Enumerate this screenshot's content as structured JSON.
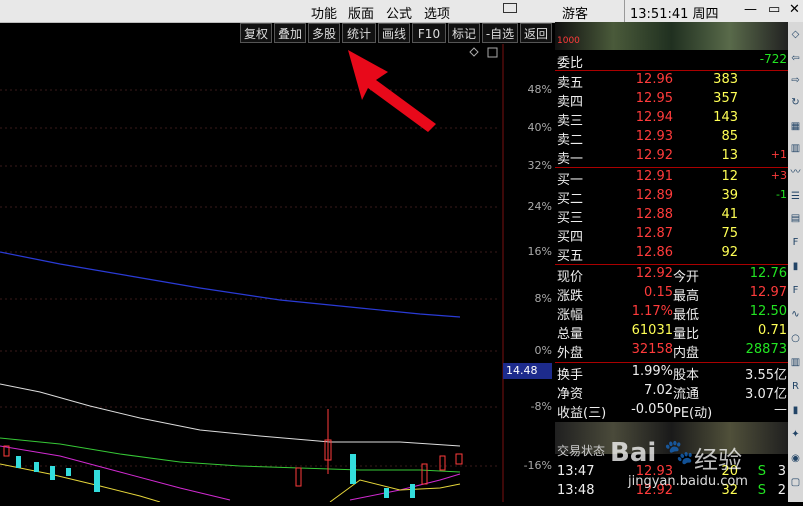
{
  "menu": {
    "items": [
      "功能",
      "版面",
      "公式",
      "选项"
    ],
    "mail_icon": "mail-icon",
    "user": "游客",
    "clock": "13:51:41 周四",
    "window_controls": [
      "—",
      "▭",
      "✕"
    ]
  },
  "toolbar": {
    "buttons": [
      "复权",
      "叠加",
      "多股",
      "统计",
      "画线",
      "F10",
      "标记",
      "-自选",
      "返回"
    ]
  },
  "chart": {
    "y_axis_labels": [
      "48%",
      "40%",
      "32%",
      "24%",
      "16%",
      "8%",
      "0%",
      "-8%",
      "-16%"
    ],
    "price_marker": "14.48",
    "colors": {
      "blue_line": "#2a3bd6",
      "white_line": "#dddddd",
      "green_line": "#36c836",
      "magenta_line": "#d12ad1",
      "yellow_line": "#e5d53a",
      "up_candle": "#ff3b3b",
      "down_candle": "#33dddd"
    }
  },
  "quote": {
    "header_code": "1000",
    "weibi": {
      "label": "委比",
      "value": "-722"
    },
    "asks": [
      {
        "label": "卖五",
        "price": "12.96",
        "vol": "383",
        "chg": ""
      },
      {
        "label": "卖四",
        "price": "12.95",
        "vol": "357",
        "chg": ""
      },
      {
        "label": "卖三",
        "price": "12.94",
        "vol": "143",
        "chg": ""
      },
      {
        "label": "卖二",
        "price": "12.93",
        "vol": "85",
        "chg": ""
      },
      {
        "label": "卖一",
        "price": "12.92",
        "vol": "13",
        "chg": "+1"
      }
    ],
    "bids": [
      {
        "label": "买一",
        "price": "12.91",
        "vol": "12",
        "chg": "+3"
      },
      {
        "label": "买二",
        "price": "12.89",
        "vol": "39",
        "chg": "-1"
      },
      {
        "label": "买三",
        "price": "12.88",
        "vol": "41",
        "chg": ""
      },
      {
        "label": "买四",
        "price": "12.87",
        "vol": "75",
        "chg": ""
      },
      {
        "label": "买五",
        "price": "12.86",
        "vol": "92",
        "chg": ""
      }
    ],
    "stats": [
      {
        "l1": "现价",
        "v1": "12.92",
        "l2": "今开",
        "v2": "12.76"
      },
      {
        "l1": "涨跌",
        "v1": "0.15",
        "l2": "最高",
        "v2": "12.97"
      },
      {
        "l1": "涨幅",
        "v1": "1.17%",
        "l2": "最低",
        "v2": "12.50"
      },
      {
        "l1": "总量",
        "v1": "61031",
        "l2": "量比",
        "v2": "0.71"
      },
      {
        "l1": "外盘",
        "v1": "32158",
        "l2": "内盘",
        "v2": "28873"
      }
    ],
    "stats2": [
      {
        "l1": "换手",
        "v1": "1.99%",
        "l2": "股本",
        "v2": "3.55亿"
      },
      {
        "l1": "净资",
        "v1": "7.02",
        "l2": "流通",
        "v2": "3.07亿"
      },
      {
        "l1": "收益(三)",
        "v1": "-0.050",
        "l2": "PE(动)",
        "v2": "—"
      }
    ],
    "status_label": "交易状态",
    "ticks": [
      {
        "time": "13:47",
        "price": "12.93",
        "vol": "20",
        "side": "S",
        "n": "3"
      },
      {
        "time": "13:48",
        "price": "12.92",
        "vol": "32",
        "side": "S",
        "n": "2"
      }
    ]
  },
  "watermark": {
    "brand": "Bai",
    "brand2": "经验",
    "url": "jingyan.baidu.com"
  }
}
